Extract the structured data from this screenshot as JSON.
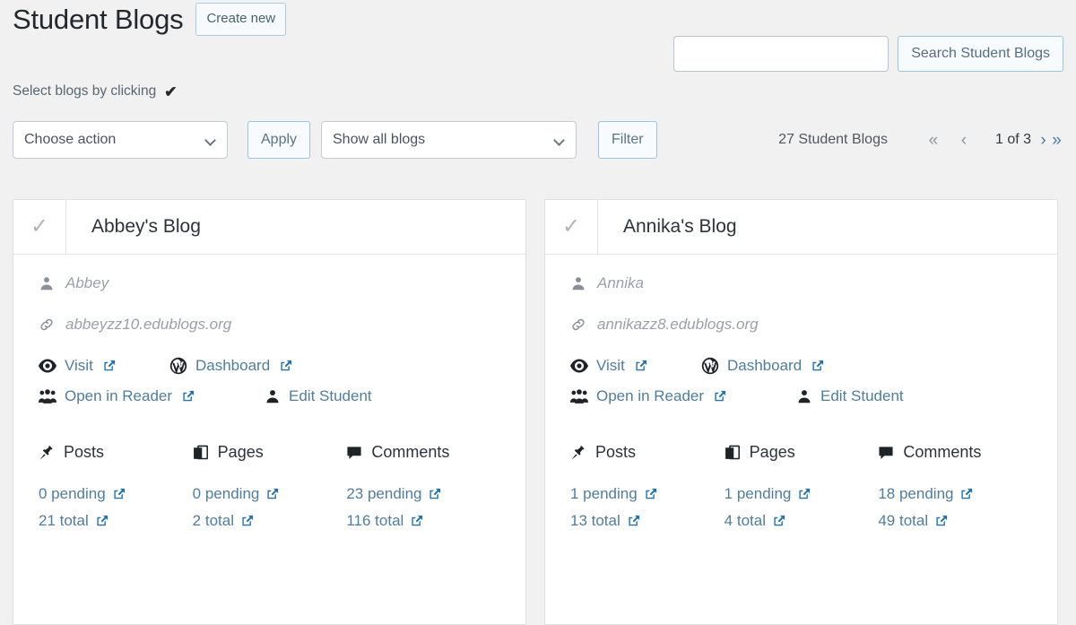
{
  "header": {
    "title": "Student Blogs",
    "create_new_label": "Create new"
  },
  "search": {
    "value": "",
    "placeholder": "",
    "button_label": "Search Student Blogs"
  },
  "select_hint": {
    "text": "Select blogs by clicking",
    "check_glyph": "✔"
  },
  "actionbar": {
    "action_select": "Choose action",
    "apply_label": "Apply",
    "filter_select": "Show all blogs",
    "filter_label": "Filter"
  },
  "pagination": {
    "count_label": "27 Student Blogs",
    "first_glyph": "«",
    "prev_glyph": "‹",
    "current_label": "1 of 3",
    "next_glyph": "›",
    "last_glyph": "»"
  },
  "cards": [
    {
      "check_glyph": "✓",
      "title": "Abbey's Blog",
      "student": "Abbey",
      "url": "abbeyzz10.edublogs.org",
      "links": {
        "visit": "Visit",
        "dashboard": "Dashboard",
        "reader": "Open in Reader",
        "edit_student": "Edit Student"
      },
      "stats": [
        {
          "label": "Posts",
          "icon": "pin-icon",
          "pending": "0 pending",
          "total": "21 total"
        },
        {
          "label": "Pages",
          "icon": "pages-icon",
          "pending": "0 pending",
          "total": "2 total"
        },
        {
          "label": "Comments",
          "icon": "comment-icon",
          "pending": "23 pending",
          "total": "116 total"
        }
      ]
    },
    {
      "check_glyph": "✓",
      "title": "Annika's Blog",
      "student": "Annika",
      "url": "annikazz8.edublogs.org",
      "links": {
        "visit": "Visit",
        "dashboard": "Dashboard",
        "reader": "Open in Reader",
        "edit_student": "Edit Student"
      },
      "stats": [
        {
          "label": "Posts",
          "icon": "pin-icon",
          "pending": "1 pending",
          "total": "13 total"
        },
        {
          "label": "Pages",
          "icon": "pages-icon",
          "pending": "1 pending",
          "total": "4 total"
        },
        {
          "label": "Comments",
          "icon": "comment-icon",
          "pending": "18 pending",
          "total": "49 total"
        }
      ]
    }
  ],
  "colors": {
    "page_bg": "#f1f1f1",
    "card_bg": "#ffffff",
    "link": "#4f7d9e",
    "accent_border": "#9ec3de",
    "external_icon": "#2271b1"
  }
}
